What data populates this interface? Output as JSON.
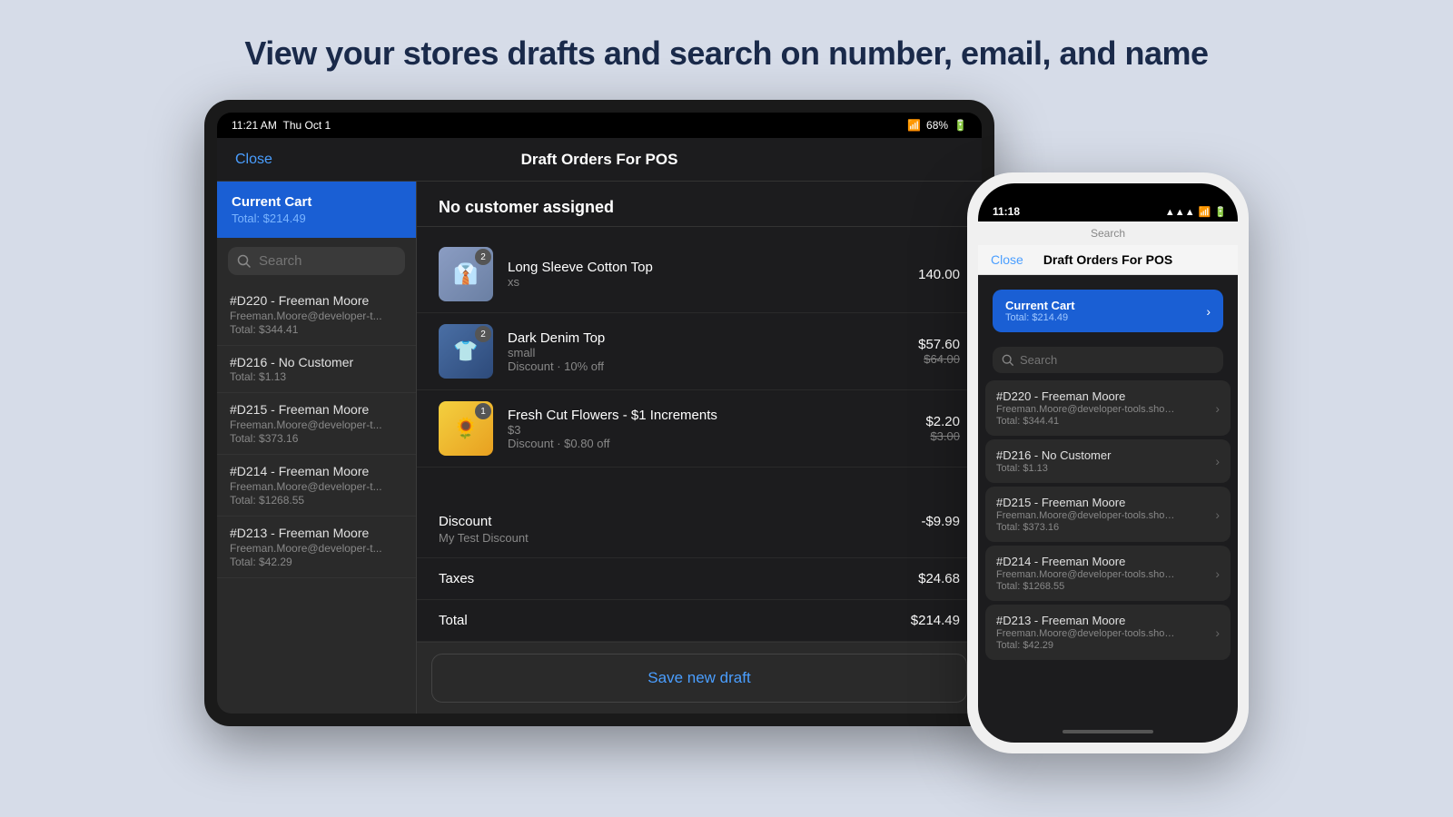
{
  "page": {
    "title": "View your stores drafts and search on number, email, and name"
  },
  "tablet": {
    "status_bar": {
      "time": "11:21 AM",
      "date": "Thu Oct 1",
      "wifi": "wifi",
      "battery": "68%"
    },
    "nav": {
      "close_label": "Close",
      "title": "Draft Orders For POS"
    },
    "sidebar": {
      "current_cart": {
        "title": "Current Cart",
        "total": "Total: $214.49"
      },
      "search_placeholder": "Search",
      "items": [
        {
          "id": "#D220",
          "name": "#D220 - Freeman Moore",
          "email": "Freeman.Moore@developer-t...",
          "total": "Total: $344.41"
        },
        {
          "id": "#D216",
          "name": "#D216 - No Customer",
          "email": "",
          "total": "Total: $1.13"
        },
        {
          "id": "#D215",
          "name": "#D215 - Freeman Moore",
          "email": "Freeman.Moore@developer-t...",
          "total": "Total: $373.16"
        },
        {
          "id": "#D214",
          "name": "#D214 - Freeman Moore",
          "email": "Freeman.Moore@developer-t...",
          "total": "Total: $1268.55"
        },
        {
          "id": "#D213",
          "name": "#D213 - Freeman Moore",
          "email": "Freeman.Moore@developer-t...",
          "total": "Total: $42.29"
        }
      ]
    },
    "main": {
      "no_customer": "No customer assigned",
      "items": [
        {
          "name": "Long Sleeve Cotton Top",
          "variant": "xs",
          "badge": "2",
          "price": "140.00",
          "original_price": "",
          "discount": "",
          "img_class": "img-cotton-top",
          "emoji": "👔"
        },
        {
          "name": "Dark Denim Top",
          "variant": "small",
          "badge": "2",
          "price": "$57.60",
          "original_price": "$64.00",
          "discount": "Discount · 10% off",
          "img_class": "img-denim-top",
          "emoji": "👕"
        },
        {
          "name": "Fresh Cut Flowers - $1 Increments",
          "variant": "$3",
          "badge": "1",
          "price": "$2.20",
          "original_price": "$3.00",
          "discount": "Discount · $0.80 off",
          "img_class": "img-flowers",
          "emoji": "🌻"
        }
      ],
      "discount": {
        "label": "Discount",
        "sub": "My Test Discount",
        "value": "-$9.99"
      },
      "taxes": {
        "label": "Taxes",
        "value": "$24.68"
      },
      "total": {
        "label": "Total",
        "value": "$214.49"
      },
      "save_button": "Save new draft"
    }
  },
  "phone": {
    "status_bar": {
      "time": "11:18",
      "search_label": "Search",
      "signal": "signal",
      "wifi": "wifi",
      "battery": "battery"
    },
    "nav": {
      "close_label": "Close",
      "title": "Draft Orders For POS"
    },
    "current_cart": {
      "title": "Current Cart",
      "total": "Total: $214.49"
    },
    "search_placeholder": "Search",
    "items": [
      {
        "id": "#D220",
        "name": "#D220 - Freeman Moore",
        "email": "Freeman.Moore@developer-tools.shopifya...",
        "total": "Total: $344.41"
      },
      {
        "id": "#D216",
        "name": "#D216 - No Customer",
        "email": "",
        "total": "Total: $1.13"
      },
      {
        "id": "#D215",
        "name": "#D215 - Freeman Moore",
        "email": "Freeman.Moore@developer-tools.shopifya...",
        "total": "Total: $373.16"
      },
      {
        "id": "#D214",
        "name": "#D214 - Freeman Moore",
        "email": "Freeman.Moore@developer-tools.shopifya...",
        "total": "Total: $1268.55"
      },
      {
        "id": "#D213",
        "name": "#D213 - Freeman Moore",
        "email": "Freeman.Moore@developer-tools.shopifya...",
        "total": "Total: $42.29"
      }
    ]
  }
}
